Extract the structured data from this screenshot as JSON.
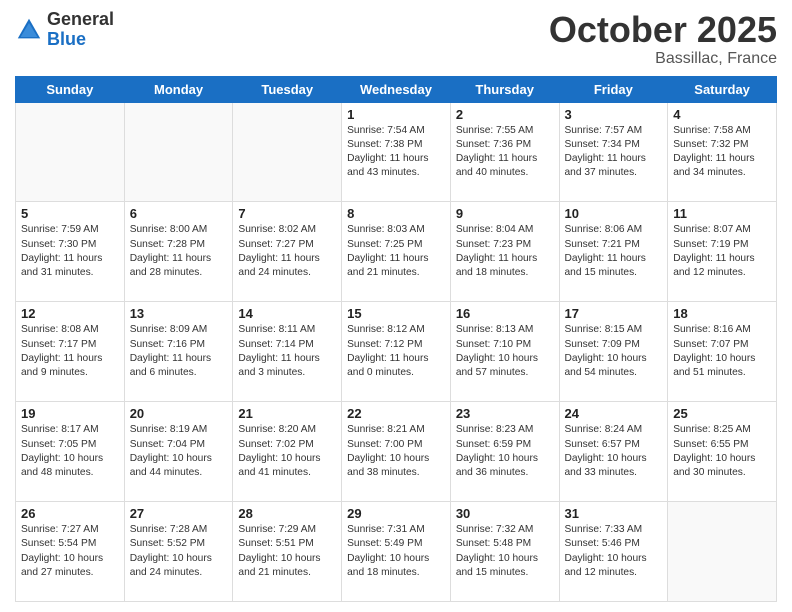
{
  "header": {
    "logo_general": "General",
    "logo_blue": "Blue",
    "title": "October 2025",
    "location": "Bassillac, France"
  },
  "days_of_week": [
    "Sunday",
    "Monday",
    "Tuesday",
    "Wednesday",
    "Thursday",
    "Friday",
    "Saturday"
  ],
  "weeks": [
    [
      {
        "day": "",
        "info": ""
      },
      {
        "day": "",
        "info": ""
      },
      {
        "day": "",
        "info": ""
      },
      {
        "day": "1",
        "info": "Sunrise: 7:54 AM\nSunset: 7:38 PM\nDaylight: 11 hours\nand 43 minutes."
      },
      {
        "day": "2",
        "info": "Sunrise: 7:55 AM\nSunset: 7:36 PM\nDaylight: 11 hours\nand 40 minutes."
      },
      {
        "day": "3",
        "info": "Sunrise: 7:57 AM\nSunset: 7:34 PM\nDaylight: 11 hours\nand 37 minutes."
      },
      {
        "day": "4",
        "info": "Sunrise: 7:58 AM\nSunset: 7:32 PM\nDaylight: 11 hours\nand 34 minutes."
      }
    ],
    [
      {
        "day": "5",
        "info": "Sunrise: 7:59 AM\nSunset: 7:30 PM\nDaylight: 11 hours\nand 31 minutes."
      },
      {
        "day": "6",
        "info": "Sunrise: 8:00 AM\nSunset: 7:28 PM\nDaylight: 11 hours\nand 28 minutes."
      },
      {
        "day": "7",
        "info": "Sunrise: 8:02 AM\nSunset: 7:27 PM\nDaylight: 11 hours\nand 24 minutes."
      },
      {
        "day": "8",
        "info": "Sunrise: 8:03 AM\nSunset: 7:25 PM\nDaylight: 11 hours\nand 21 minutes."
      },
      {
        "day": "9",
        "info": "Sunrise: 8:04 AM\nSunset: 7:23 PM\nDaylight: 11 hours\nand 18 minutes."
      },
      {
        "day": "10",
        "info": "Sunrise: 8:06 AM\nSunset: 7:21 PM\nDaylight: 11 hours\nand 15 minutes."
      },
      {
        "day": "11",
        "info": "Sunrise: 8:07 AM\nSunset: 7:19 PM\nDaylight: 11 hours\nand 12 minutes."
      }
    ],
    [
      {
        "day": "12",
        "info": "Sunrise: 8:08 AM\nSunset: 7:17 PM\nDaylight: 11 hours\nand 9 minutes."
      },
      {
        "day": "13",
        "info": "Sunrise: 8:09 AM\nSunset: 7:16 PM\nDaylight: 11 hours\nand 6 minutes."
      },
      {
        "day": "14",
        "info": "Sunrise: 8:11 AM\nSunset: 7:14 PM\nDaylight: 11 hours\nand 3 minutes."
      },
      {
        "day": "15",
        "info": "Sunrise: 8:12 AM\nSunset: 7:12 PM\nDaylight: 11 hours\nand 0 minutes."
      },
      {
        "day": "16",
        "info": "Sunrise: 8:13 AM\nSunset: 7:10 PM\nDaylight: 10 hours\nand 57 minutes."
      },
      {
        "day": "17",
        "info": "Sunrise: 8:15 AM\nSunset: 7:09 PM\nDaylight: 10 hours\nand 54 minutes."
      },
      {
        "day": "18",
        "info": "Sunrise: 8:16 AM\nSunset: 7:07 PM\nDaylight: 10 hours\nand 51 minutes."
      }
    ],
    [
      {
        "day": "19",
        "info": "Sunrise: 8:17 AM\nSunset: 7:05 PM\nDaylight: 10 hours\nand 48 minutes."
      },
      {
        "day": "20",
        "info": "Sunrise: 8:19 AM\nSunset: 7:04 PM\nDaylight: 10 hours\nand 44 minutes."
      },
      {
        "day": "21",
        "info": "Sunrise: 8:20 AM\nSunset: 7:02 PM\nDaylight: 10 hours\nand 41 minutes."
      },
      {
        "day": "22",
        "info": "Sunrise: 8:21 AM\nSunset: 7:00 PM\nDaylight: 10 hours\nand 38 minutes."
      },
      {
        "day": "23",
        "info": "Sunrise: 8:23 AM\nSunset: 6:59 PM\nDaylight: 10 hours\nand 36 minutes."
      },
      {
        "day": "24",
        "info": "Sunrise: 8:24 AM\nSunset: 6:57 PM\nDaylight: 10 hours\nand 33 minutes."
      },
      {
        "day": "25",
        "info": "Sunrise: 8:25 AM\nSunset: 6:55 PM\nDaylight: 10 hours\nand 30 minutes."
      }
    ],
    [
      {
        "day": "26",
        "info": "Sunrise: 7:27 AM\nSunset: 5:54 PM\nDaylight: 10 hours\nand 27 minutes."
      },
      {
        "day": "27",
        "info": "Sunrise: 7:28 AM\nSunset: 5:52 PM\nDaylight: 10 hours\nand 24 minutes."
      },
      {
        "day": "28",
        "info": "Sunrise: 7:29 AM\nSunset: 5:51 PM\nDaylight: 10 hours\nand 21 minutes."
      },
      {
        "day": "29",
        "info": "Sunrise: 7:31 AM\nSunset: 5:49 PM\nDaylight: 10 hours\nand 18 minutes."
      },
      {
        "day": "30",
        "info": "Sunrise: 7:32 AM\nSunset: 5:48 PM\nDaylight: 10 hours\nand 15 minutes."
      },
      {
        "day": "31",
        "info": "Sunrise: 7:33 AM\nSunset: 5:46 PM\nDaylight: 10 hours\nand 12 minutes."
      },
      {
        "day": "",
        "info": ""
      }
    ]
  ]
}
